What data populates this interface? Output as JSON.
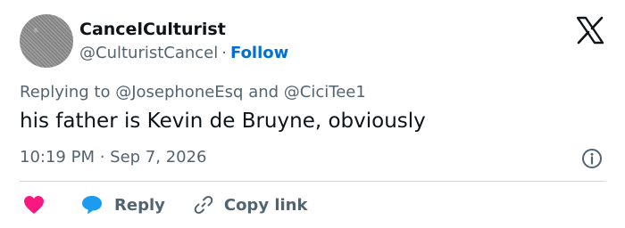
{
  "author": {
    "display_name": "CancelCulturist",
    "handle": "@CulturistCancel",
    "separator": "·",
    "follow_label": "Follow"
  },
  "reply_context": {
    "text": "Replying to @JosephoneEsq and @CiciTee1"
  },
  "tweet": {
    "text": "his father is Kevin de Bruyne, obviously",
    "timestamp": "10:19 PM · Sep 7, 2026"
  },
  "actions": {
    "reply_label": "Reply",
    "copy_link_label": "Copy link"
  },
  "icons": {
    "brand": "x-logo-icon",
    "info": "info-icon",
    "like": "heart-icon",
    "reply": "speech-bubble-icon",
    "copy": "link-icon"
  },
  "colors": {
    "accent": "#006fd6",
    "like": "#f91880",
    "reply": "#1d9bf0",
    "secondary_text": "#536471",
    "divider": "#cfd9de"
  }
}
